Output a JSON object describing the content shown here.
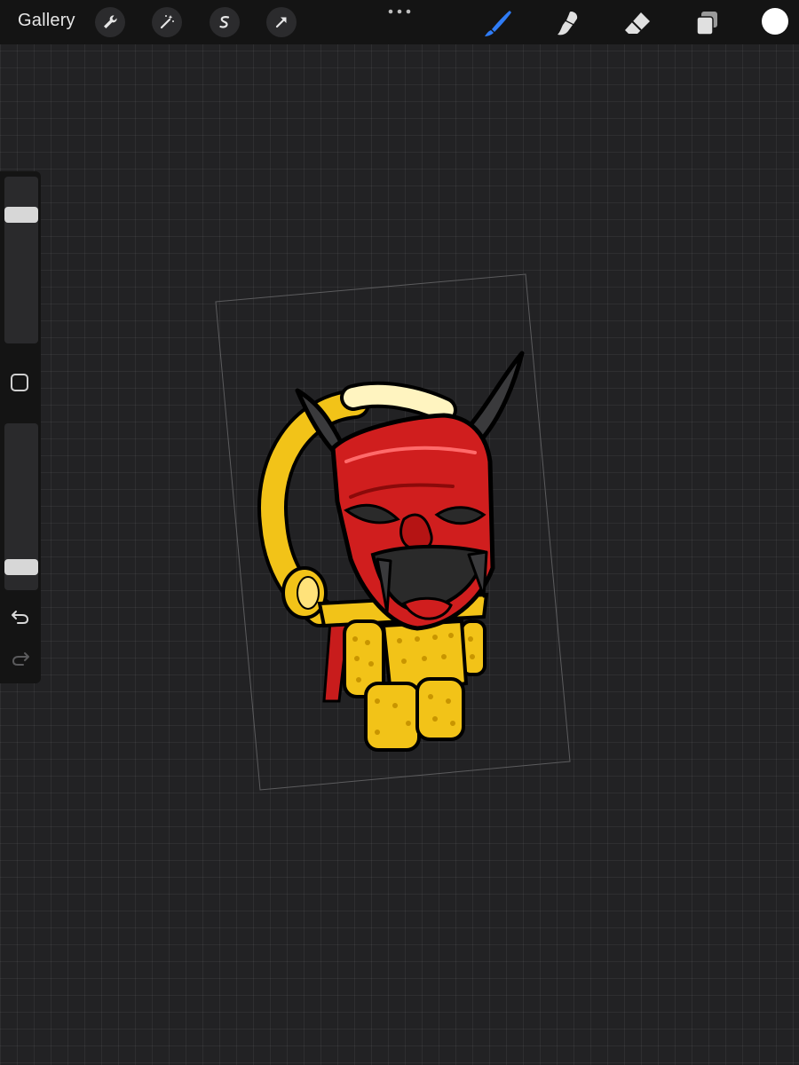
{
  "topbar": {
    "gallery_label": "Gallery",
    "left_tools": [
      {
        "name": "actions-wrench-icon"
      },
      {
        "name": "adjustments-magic-wand-icon"
      },
      {
        "name": "selection-s-icon"
      },
      {
        "name": "transform-arrow-icon"
      }
    ],
    "more_icon": "more-dots-icon",
    "right_tools": [
      {
        "name": "brush-icon",
        "active": true
      },
      {
        "name": "smudge-icon"
      },
      {
        "name": "eraser-icon"
      },
      {
        "name": "layers-icon"
      }
    ],
    "active_color": "#ffffff",
    "accent_color": "#2f7cf6"
  },
  "sidebar": {
    "brush_size_level": 0.8,
    "opacity_level": 0.1
  },
  "canvas": {
    "background_color": "#222224",
    "artwork": "oni-mask-samurai-illustration",
    "mask_color": "#d01e1e",
    "armor_color": "#f2c318",
    "horn_color": "#3a3a3c"
  }
}
